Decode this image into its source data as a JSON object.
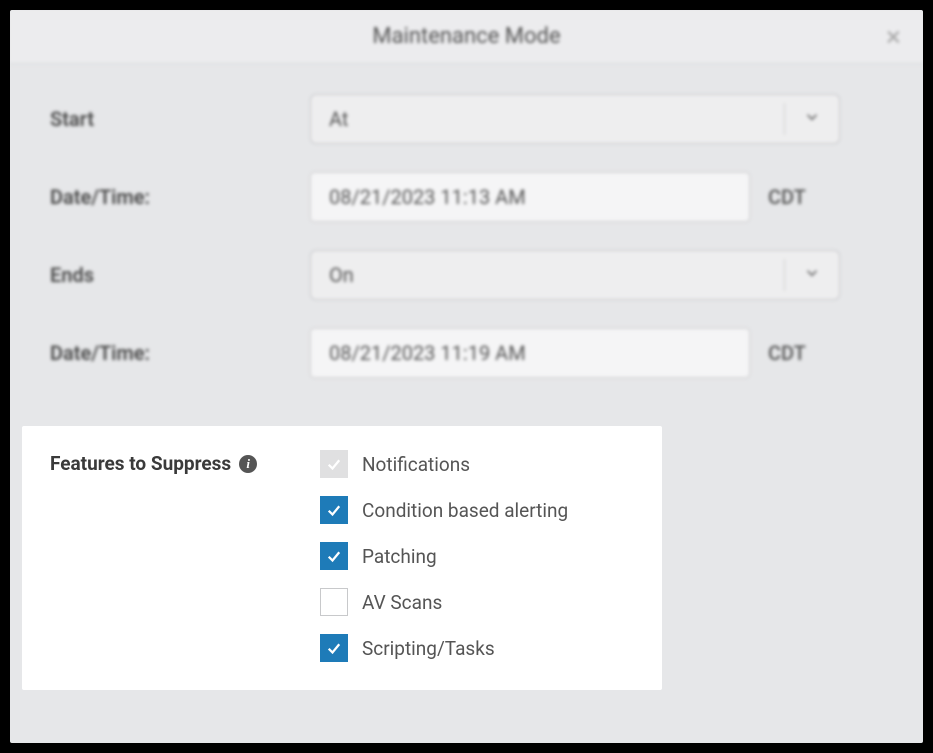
{
  "dialog": {
    "title": "Maintenance Mode"
  },
  "form": {
    "start_label": "Start",
    "start_value": "At",
    "start_datetime_label": "Date/Time:",
    "start_datetime_value": "08/21/2023 11:13 AM",
    "start_tz": "CDT",
    "ends_label": "Ends",
    "ends_value": "On",
    "ends_datetime_label": "Date/Time:",
    "ends_datetime_value": "08/21/2023 11:19 AM",
    "ends_tz": "CDT"
  },
  "suppress": {
    "title": "Features to Suppress",
    "items": [
      {
        "label": "Notifications",
        "checked": true,
        "disabled": true
      },
      {
        "label": "Condition based alerting",
        "checked": true,
        "disabled": false
      },
      {
        "label": "Patching",
        "checked": true,
        "disabled": false
      },
      {
        "label": "AV Scans",
        "checked": false,
        "disabled": false
      },
      {
        "label": "Scripting/Tasks",
        "checked": true,
        "disabled": false
      }
    ]
  }
}
